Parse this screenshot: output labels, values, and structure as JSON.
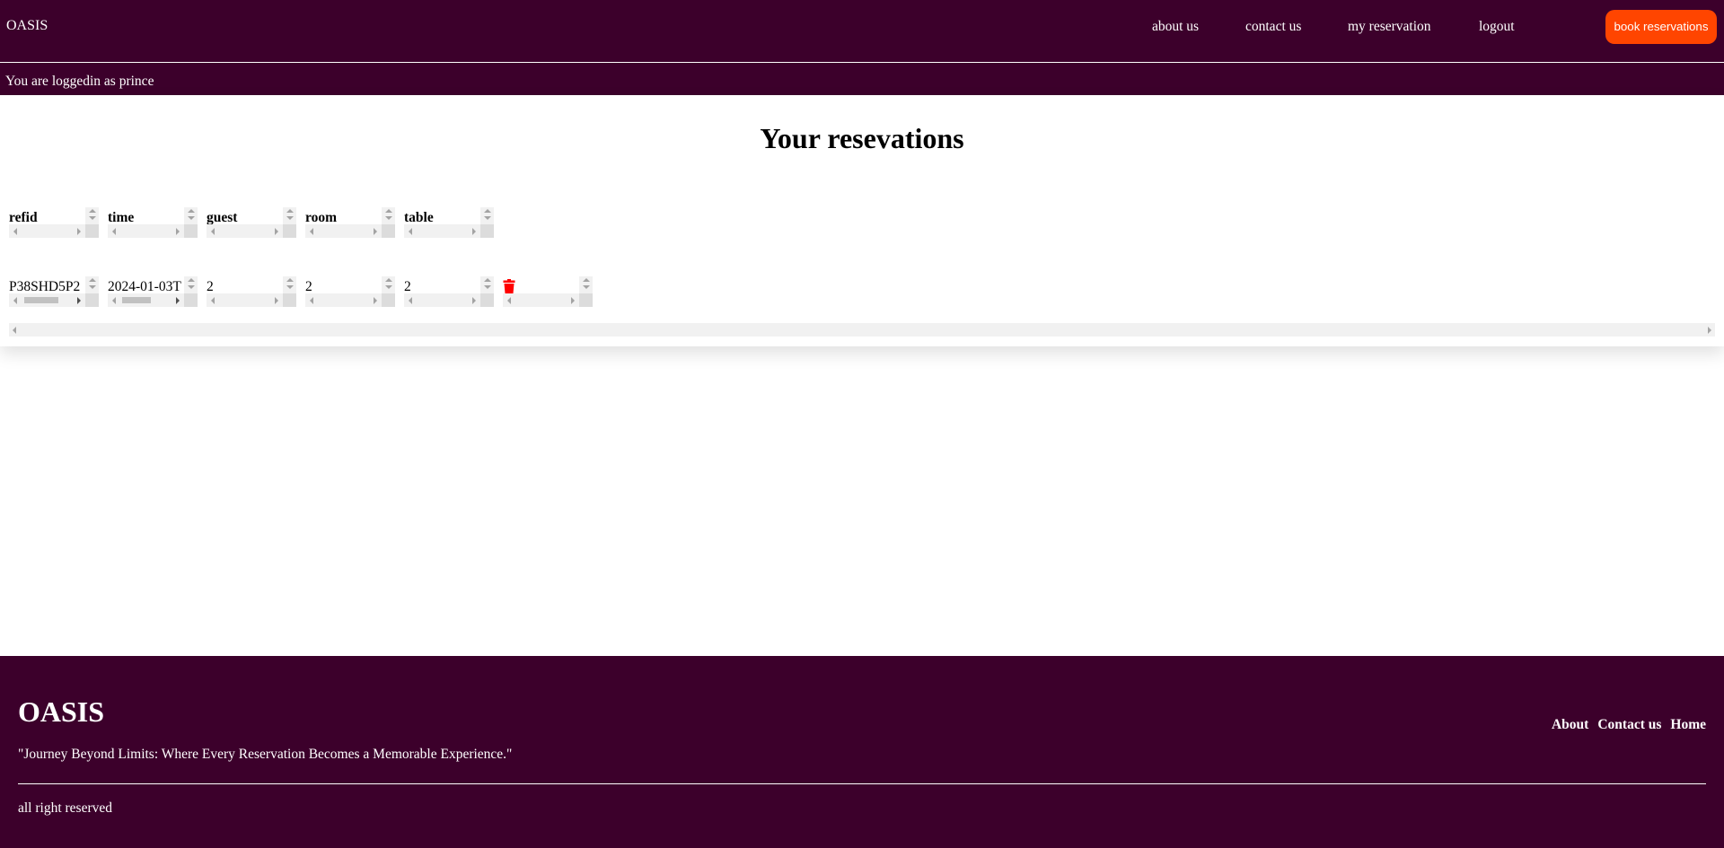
{
  "header": {
    "brand": "OASIS",
    "nav": [
      "about us",
      "contact us",
      "my reservation",
      "logout"
    ],
    "book_button": "book reservations",
    "logged_in_text": "You are loggedin as prince"
  },
  "main": {
    "title": "Your resevations",
    "columns": [
      "refid",
      "time",
      "guest",
      "room",
      "table"
    ],
    "rows": [
      {
        "refid": "P38SHD5P2",
        "time": "2024-01-03T",
        "guest": "2",
        "room": "2",
        "table": "2"
      }
    ],
    "delete_icon": "trash-icon"
  },
  "footer": {
    "brand": "OASIS",
    "tagline": "\"Journey Beyond Limits: Where Every Reservation Becomes a Memorable Experience.\"",
    "links": [
      "About",
      "Contact us",
      "Home"
    ],
    "rights": "all right reserved"
  },
  "colors": {
    "primary": "#3c002b",
    "accent": "#ff4500",
    "danger": "#ff0000"
  }
}
